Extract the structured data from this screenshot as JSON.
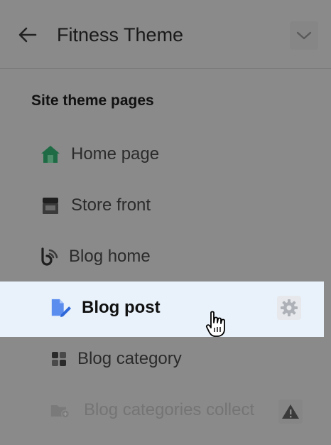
{
  "header": {
    "title": "Fitness Theme"
  },
  "section": {
    "title": "Site theme pages"
  },
  "pages": [
    {
      "label": "Home page",
      "icon": "home-icon"
    },
    {
      "label": "Store front",
      "icon": "store-icon"
    },
    {
      "label": "Blog home",
      "icon": "blog-home-icon"
    },
    {
      "label": "Blog post",
      "icon": "blog-post-icon",
      "active": true
    },
    {
      "label": "Blog category",
      "icon": "grid-icon"
    },
    {
      "label": "Blog categories collect",
      "icon": "folder-add-icon",
      "disabled": true
    }
  ],
  "colors": {
    "overlay": "#8a8a8a",
    "active_row": "#e9f2fb",
    "home_icon": "#1f6b45",
    "blog_post_icon": "#5b8def"
  }
}
